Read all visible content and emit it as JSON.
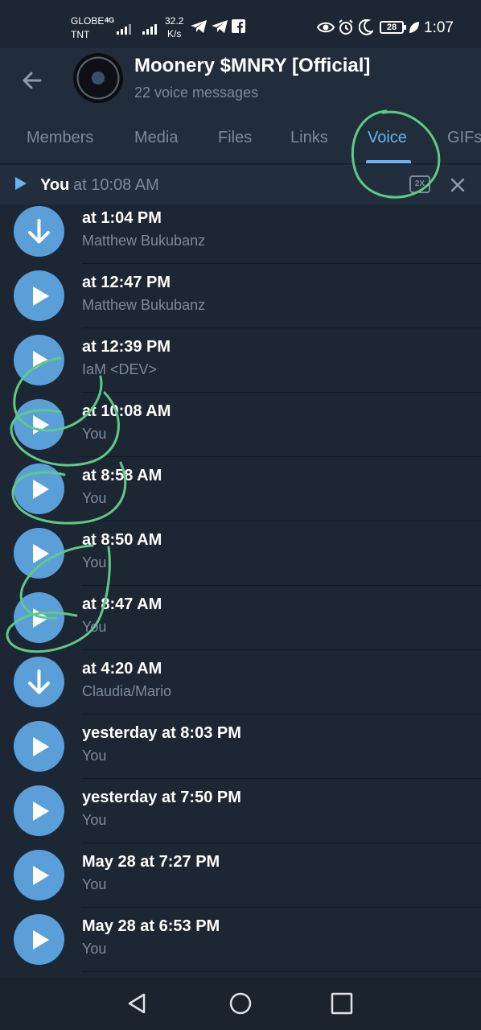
{
  "status_bar": {
    "carrier_line1": "GLOBE",
    "carrier_line2": "TNT",
    "network": "4G",
    "speed_value": "32.2",
    "speed_unit": "K/s",
    "battery": "28",
    "time": "1:07"
  },
  "header": {
    "title": "Moonery $MNRY [Official]",
    "subtitle": "22 voice messages"
  },
  "tabs": [
    {
      "label": "Members",
      "active": false
    },
    {
      "label": "Media",
      "active": false
    },
    {
      "label": "Files",
      "active": false
    },
    {
      "label": "Links",
      "active": false
    },
    {
      "label": "Voice",
      "active": true
    },
    {
      "label": "GIFs",
      "active": false
    }
  ],
  "player": {
    "name": "You",
    "time": "at 10:08 AM",
    "speed": "2X"
  },
  "messages": [
    {
      "title": "at 1:04 PM",
      "sender": "Matthew Bukubanz",
      "icon": "download-icon"
    },
    {
      "title": "at 12:47 PM",
      "sender": "Matthew Bukubanz",
      "icon": "play-icon"
    },
    {
      "title": "at 12:39 PM",
      "sender": "IaM <DEV>",
      "icon": "play-icon"
    },
    {
      "title": "at 10:08 AM",
      "sender": "You",
      "icon": "play-icon"
    },
    {
      "title": "at 8:58 AM",
      "sender": "You",
      "icon": "play-icon"
    },
    {
      "title": "at 8:50 AM",
      "sender": "You",
      "icon": "play-icon"
    },
    {
      "title": "at 8:47 AM",
      "sender": "You",
      "icon": "play-icon"
    },
    {
      "title": "at 4:20 AM",
      "sender": "Claudia/Mario",
      "icon": "download-icon"
    },
    {
      "title": "yesterday at 8:03 PM",
      "sender": "You",
      "icon": "play-icon"
    },
    {
      "title": "yesterday at 7:50 PM",
      "sender": "You",
      "icon": "play-icon"
    },
    {
      "title": "May 28 at 7:27 PM",
      "sender": "You",
      "icon": "play-icon"
    },
    {
      "title": "May 28 at 6:53 PM",
      "sender": "You",
      "icon": "play-icon"
    }
  ],
  "colors": {
    "background": "#1d2733",
    "header": "#212d3b",
    "accent": "#6ab3f3",
    "button": "#5b9fd9",
    "secondary_text": "#7c8a99",
    "annotation": "#5fc98a"
  }
}
